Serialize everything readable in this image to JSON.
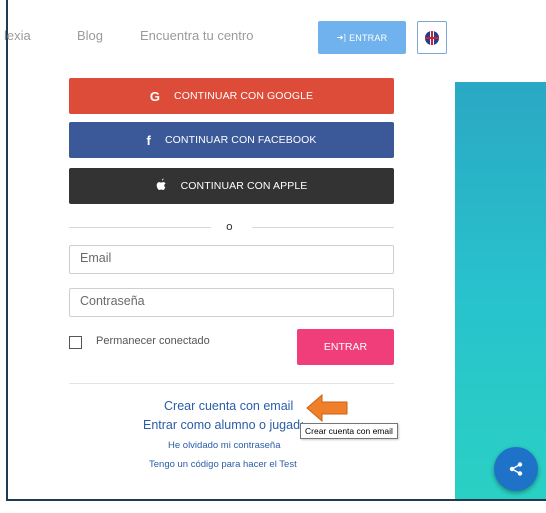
{
  "nav": {
    "links": [
      "lexia",
      "Blog",
      "Encuentra tu centro"
    ],
    "enter_label": "ENTRAR",
    "language_icon": "uk-flag-icon"
  },
  "social": {
    "google_label": "CONTINUAR CON GOOGLE",
    "facebook_label": "CONTINUAR CON FACEBOOK",
    "apple_label": "CONTINUAR CON APPLE"
  },
  "divider_text": "o",
  "form": {
    "email_placeholder": "Email",
    "password_placeholder": "Contraseña",
    "remember_label": "Permanecer conectado",
    "submit_label": "ENTRAR"
  },
  "links": {
    "create_account": "Crear cuenta con email",
    "student_login": "Entrar como alumno o jugador",
    "forgot_password": "He olvidado mi contraseña",
    "test_code": "Tengo un código para hacer el Test"
  },
  "tooltip": "Crear cuenta con email",
  "colors": {
    "google": "#dd4b39",
    "facebook": "#3b5998",
    "apple": "#333333",
    "submit": "#ef3e7a",
    "enter": "#6fb2ee",
    "teal": "#28c2cc",
    "share": "#1e73c8"
  }
}
